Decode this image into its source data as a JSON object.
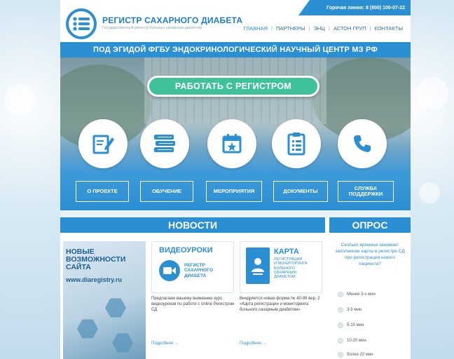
{
  "header": {
    "hotline": "Горячая линия: 8 (800) 100-07-22",
    "logo_title": "РЕГИСТР САХАРНОГО ДИАБЕТА",
    "logo_subtitle": "Государственный регистр больных сахарным диабетом",
    "nav": [
      "ГЛАВНАЯ",
      "ПАРТНЕРЫ",
      "ЭНЦ",
      "АСТОН ГРУП",
      "КОНТАКТЫ"
    ]
  },
  "banner": {
    "text": "ПОД ЭГИДОЙ ФГБУ ЭНДОКРИНОЛОГИЧЕСКИЙ НАУЧНЫЙ ЦЕНТР МЗ РФ"
  },
  "hero": {
    "cta": "РАБОТАТЬ С РЕГИСТРОМ",
    "icons": [
      "edit-document-icon",
      "books-icon",
      "calendar-star-icon",
      "clipboard-list-icon",
      "phone-icon"
    ],
    "buttons": [
      "О ПРОЕКТЕ",
      "ОБУЧЕНИЕ",
      "МЕРОПРИЯТИЯ",
      "ДОКУМЕНТЫ",
      "СЛУЖБА\nПОДДЕРЖКИ"
    ]
  },
  "news": {
    "title": "НОВОСТИ",
    "featured": {
      "title": "НОВЫЕ\nВОЗМОЖНОСТИ\nСАЙТА",
      "url": "www.diaregistry.ru"
    },
    "cards": [
      {
        "img_title": "ВИДЕОУРОКИ",
        "img_sub": "РЕГИСТР\nСАХАРНОГО\nДИАБЕТА",
        "text": "Предлагаем вашему вниманию курс видеоуроков по работе с online Регистром СД",
        "more": "Подробнее →"
      },
      {
        "img_title": "КАРТА",
        "img_sub": "РЕГИСТРАЦИИ\nИ МОНИТОРИНГА\nБОЛЬНОГО\nСАХАРНЫМ\nДИАБЕТОМ",
        "text": "Внедряется новая форма № 40-99 вер. 2 «Карта регистрации и мониторинга больного сахарным диабетом»",
        "more": "Подробнее →"
      }
    ]
  },
  "poll": {
    "title": "ОПРОС",
    "question": "Сколько времени занимает заполнение карты в регистре СД при регистрации нового пациента?",
    "options": [
      "Менее 3-х мин",
      "3-5 мин",
      "5-10 мин",
      "10-20 мин",
      "более 20 мин"
    ]
  },
  "colors": {
    "primary": "#2b8fd3",
    "cta": "#3fc19a"
  }
}
